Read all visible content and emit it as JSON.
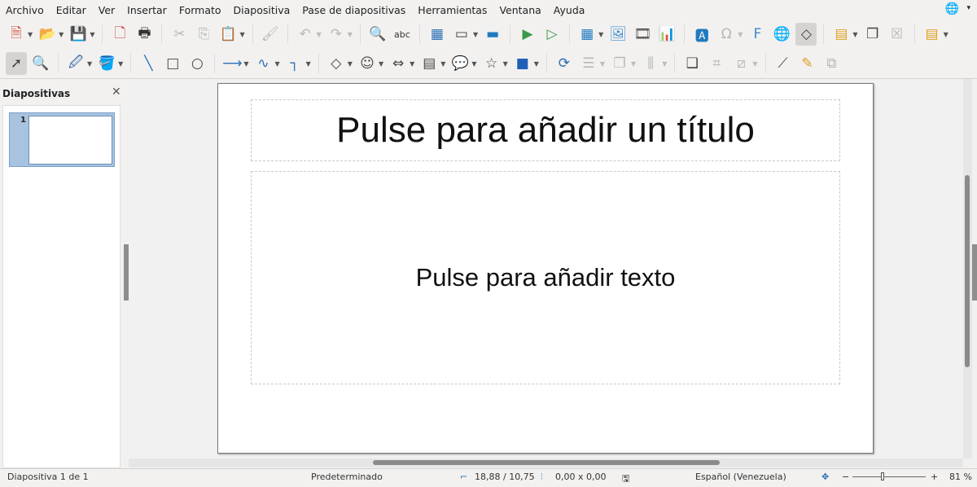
{
  "menu": [
    "Archivo",
    "Editar",
    "Ver",
    "Insertar",
    "Formato",
    "Diapositiva",
    "Pase de diapositivas",
    "Herramientas",
    "Ventana",
    "Ayuda"
  ],
  "toolbar1": [
    {
      "icon": "new-document",
      "g": "🗎",
      "c": "#d0402a",
      "dd": true
    },
    {
      "icon": "open-folder",
      "g": "📂",
      "c": "#d9a441",
      "dd": true
    },
    {
      "icon": "save",
      "g": "💾",
      "c": "#8a3b8f",
      "dd": true
    },
    {
      "sep": true
    },
    {
      "icon": "export-pdf",
      "g": "🗋",
      "c": "#c33"
    },
    {
      "icon": "print",
      "g": "🖶",
      "c": "#333"
    },
    {
      "sep": true
    },
    {
      "icon": "cut",
      "g": "✂",
      "dis": true
    },
    {
      "icon": "copy",
      "g": "⎘",
      "dis": true
    },
    {
      "icon": "paste",
      "g": "📋",
      "c": "#c9a040",
      "dd": true
    },
    {
      "sep": true
    },
    {
      "icon": "clone-formatting",
      "g": "🖌",
      "dis": true
    },
    {
      "sep": true
    },
    {
      "icon": "undo",
      "g": "↶",
      "dis": true,
      "dd": true
    },
    {
      "icon": "redo",
      "g": "↷",
      "dis": true,
      "dd": true
    },
    {
      "sep": true
    },
    {
      "icon": "find-replace",
      "g": "🔍",
      "c": "#2a6fb5"
    },
    {
      "icon": "spellcheck",
      "g": "abc",
      "c": "#333"
    },
    {
      "sep": true
    },
    {
      "icon": "grid",
      "g": "▦",
      "c": "#2a6fb5"
    },
    {
      "icon": "display-views",
      "g": "▭",
      "dd": true
    },
    {
      "icon": "master-slide",
      "g": "▬",
      "c": "#1f7ac0"
    },
    {
      "sep": true
    },
    {
      "icon": "start-from-first",
      "g": "▶",
      "c": "#3a9a4a"
    },
    {
      "icon": "start-from-current",
      "g": "▷",
      "c": "#3a9a4a"
    },
    {
      "sep": true
    },
    {
      "icon": "table",
      "g": "▦",
      "c": "#1f7ac0",
      "dd": true
    },
    {
      "icon": "image",
      "g": "🖼",
      "c": "#3a8ad0"
    },
    {
      "icon": "media",
      "g": "🎞"
    },
    {
      "icon": "chart",
      "g": "📊",
      "c": "#e0a020"
    },
    {
      "sep": true
    },
    {
      "icon": "text-box",
      "g": "🅰",
      "c": "#1f7ac0"
    },
    {
      "icon": "special-character",
      "g": "Ω",
      "dis": true,
      "dd": true
    },
    {
      "icon": "fontwork",
      "g": "F",
      "c": "#3a8ad0"
    },
    {
      "icon": "hyperlink",
      "g": "🌐"
    },
    {
      "icon": "shapes",
      "g": "◇",
      "active": true
    },
    {
      "sep": true
    },
    {
      "icon": "new-slide",
      "g": "▤",
      "c": "#e0a020",
      "dd": true
    },
    {
      "icon": "duplicate-slide",
      "g": "❐"
    },
    {
      "icon": "delete-slide",
      "g": "☒",
      "dis": true
    },
    {
      "sep": true
    },
    {
      "icon": "slide-layout",
      "g": "▤",
      "c": "#e0a020",
      "dd": true
    }
  ],
  "toolbar2": [
    {
      "icon": "select-pointer",
      "g": "➚",
      "active": true
    },
    {
      "icon": "zoom-pan",
      "g": "🔍"
    },
    {
      "sep": true
    },
    {
      "icon": "line-color",
      "g": "🖉",
      "c": "#2a5fa0",
      "dd": true
    },
    {
      "icon": "fill-color",
      "g": "🪣",
      "c": "#5b8fd0",
      "dd": true
    },
    {
      "sep": true
    },
    {
      "icon": "line",
      "g": "╲",
      "c": "#2a6fb5"
    },
    {
      "icon": "rectangle",
      "g": "□"
    },
    {
      "icon": "ellipse",
      "g": "○"
    },
    {
      "sep": true
    },
    {
      "icon": "line-arrow",
      "g": "⟶",
      "c": "#2a6fb5",
      "dd": true
    },
    {
      "icon": "curve",
      "g": "∿",
      "c": "#2a6fb5",
      "dd": true
    },
    {
      "icon": "connector",
      "g": "┐",
      "c": "#2a6fb5",
      "dd": true
    },
    {
      "sep": true
    },
    {
      "icon": "basic-shapes",
      "g": "◇",
      "dd": true
    },
    {
      "icon": "symbol-shapes",
      "g": "☺",
      "dd": true
    },
    {
      "icon": "block-arrows",
      "g": "⇔",
      "dd": true
    },
    {
      "icon": "flowchart",
      "g": "▤",
      "dd": true
    },
    {
      "icon": "callouts",
      "g": "💬",
      "dd": true
    },
    {
      "icon": "stars",
      "g": "☆",
      "dd": true
    },
    {
      "icon": "3d-objects",
      "g": "■",
      "c": "#1f5fb5",
      "dd": true
    },
    {
      "sep": true
    },
    {
      "icon": "rotate",
      "g": "⟳",
      "c": "#2a6fb5"
    },
    {
      "icon": "align",
      "g": "☰",
      "dis": true,
      "dd": true
    },
    {
      "icon": "arrange",
      "g": "❐",
      "dis": true,
      "dd": true
    },
    {
      "icon": "distribute",
      "g": "⫼",
      "dis": true,
      "dd": true
    },
    {
      "sep": true
    },
    {
      "icon": "shadow",
      "g": "❑"
    },
    {
      "icon": "crop",
      "g": "⌗",
      "dis": true
    },
    {
      "icon": "filter",
      "g": "⧄",
      "dis": true,
      "dd": true
    },
    {
      "sep": true
    },
    {
      "icon": "points",
      "g": "⟋"
    },
    {
      "icon": "glue-points",
      "g": "✎",
      "c": "#e0a020"
    },
    {
      "icon": "toggle-extrusion",
      "g": "⧉",
      "dis": true
    }
  ],
  "sidebar": {
    "title": "Diapositivas",
    "slide_number": "1"
  },
  "slide": {
    "title_placeholder": "Pulse para añadir un título",
    "body_placeholder": "Pulse para añadir texto"
  },
  "status": {
    "slide": "Diapositiva 1 de 1",
    "master": "Predeterminado",
    "position": "18,88 / 10,75",
    "size": "0,00 x 0,00",
    "language": "Español (Venezuela)",
    "zoom_minus": "−",
    "zoom_plus": "+",
    "zoom": "81 %",
    "zoom_level_percent": 81
  }
}
